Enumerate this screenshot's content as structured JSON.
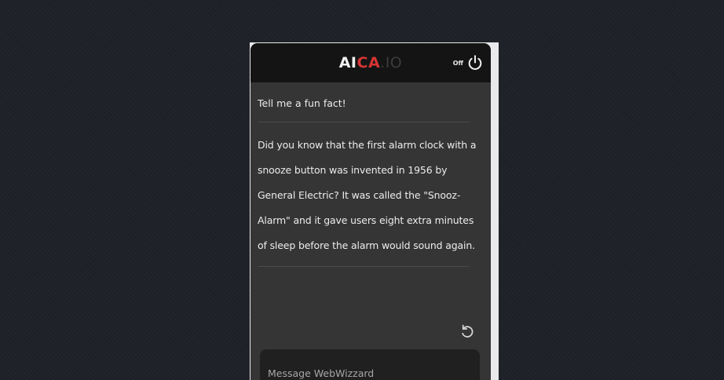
{
  "app": {
    "logo_ai": "AI",
    "logo_ca": "CA",
    "logo_io": ".IO",
    "power_label": "Off",
    "power_icon": "power-icon"
  },
  "chat": {
    "messages": [
      {
        "role": "user",
        "text": "Tell me a fun fact!"
      },
      {
        "role": "assistant",
        "text": "Did you know that the first alarm clock with a snooze button was invented in 1956 by General Electric? It was called the \"Snooz-Alarm\" and it gave users eight extra minutes of sleep before the alarm would sound again."
      }
    ],
    "regenerate_icon": "refresh-icon"
  },
  "composer": {
    "placeholder": "Message WebWizzard",
    "value": ""
  },
  "colors": {
    "background": "#1e2027",
    "panel": "#353535",
    "header": "#141414",
    "accent_red": "#d63434",
    "input": "#202020"
  }
}
